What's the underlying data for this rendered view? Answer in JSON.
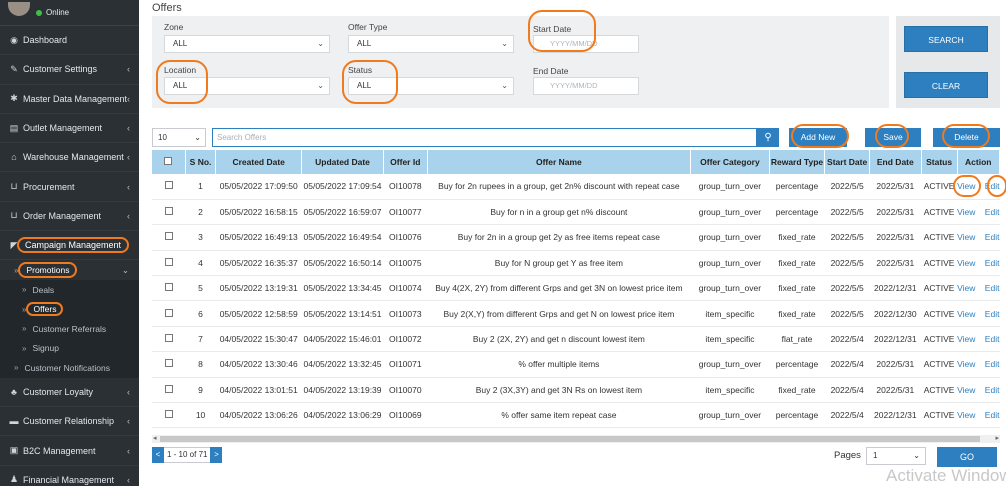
{
  "sidebar": {
    "status": "Online",
    "items": [
      {
        "label": "Dashboard",
        "icon": "dashboard-icon",
        "glyph": "◉",
        "chevron": false
      },
      {
        "label": "Customer Settings",
        "icon": "wrench-icon",
        "glyph": "✎",
        "chevron": true
      },
      {
        "label": "Master Data Management",
        "icon": "gear-icon",
        "glyph": "✱",
        "chevron": true
      },
      {
        "label": "Outlet Management",
        "icon": "outlet-icon",
        "glyph": "▤",
        "chevron": true
      },
      {
        "label": "Warehouse Management",
        "icon": "home-icon",
        "glyph": "⌂",
        "chevron": true
      },
      {
        "label": "Procurement",
        "icon": "cart-icon",
        "glyph": "⊔",
        "chevron": true
      },
      {
        "label": "Order Management",
        "icon": "cart-icon",
        "glyph": "⊔",
        "chevron": true
      }
    ],
    "campaign": "Campaign Management",
    "promotions": "Promotions",
    "promo_subs": [
      "Deals",
      "Offers",
      "Customer Referrals",
      "Signup"
    ],
    "customer_notifications": "Customer Notifications",
    "items_after": [
      {
        "label": "Customer Loyalty",
        "icon": "users-icon",
        "glyph": "♣"
      },
      {
        "label": "Customer Relationship",
        "icon": "relationship-icon",
        "glyph": "▬"
      },
      {
        "label": "B2C Management",
        "icon": "image-icon",
        "glyph": "▣"
      },
      {
        "label": "Financial Management",
        "icon": "money-icon",
        "glyph": "♟"
      }
    ]
  },
  "page": {
    "title": "Offers"
  },
  "filters": {
    "zone_label": "Zone",
    "zone_value": "ALL",
    "offer_type_label": "Offer Type",
    "offer_type_value": "ALL",
    "start_date_label": "Start Date",
    "start_date_placeholder": "YYYY/MM/DD",
    "location_label": "Location",
    "location_value": "ALL",
    "status_label": "Status",
    "status_value": "ALL",
    "end_date_label": "End Date",
    "end_date_placeholder": "YYYY/MM/DD"
  },
  "actions": {
    "search": "SEARCH",
    "clear": "CLEAR"
  },
  "toolbar": {
    "page_size": "10",
    "search_placeholder": "Search Offers",
    "add_new": "Add New",
    "save": "Save",
    "delete": "Delete"
  },
  "table": {
    "headers": [
      "S No.",
      "Created Date",
      "Updated Date",
      "Offer Id",
      "Offer Name",
      "Offer Category",
      "Reward Type",
      "Start Date",
      "End Date",
      "Status",
      "Action"
    ],
    "view_label": "View",
    "edit_label": "Edit",
    "rows": [
      {
        "sno": "1",
        "created": "05/05/2022 17:09:50",
        "updated": "05/05/2022 17:09:54",
        "id": "OI10078",
        "name": "Buy for 2n rupees in a group, get 2n% discount with repeat case",
        "category": "group_turn_over",
        "reward": "percentage",
        "start": "2022/5/5",
        "end": "2022/5/31",
        "status": "ACTIVE"
      },
      {
        "sno": "2",
        "created": "05/05/2022 16:58:15",
        "updated": "05/05/2022 16:59:07",
        "id": "OI10077",
        "name": "Buy for n in a group get n% discount",
        "category": "group_turn_over",
        "reward": "percentage",
        "start": "2022/5/5",
        "end": "2022/5/31",
        "status": "ACTIVE"
      },
      {
        "sno": "3",
        "created": "05/05/2022 16:49:13",
        "updated": "05/05/2022 16:49:54",
        "id": "OI10076",
        "name": "Buy for 2n in a group get 2y as free items repeat case",
        "category": "group_turn_over",
        "reward": "fixed_rate",
        "start": "2022/5/5",
        "end": "2022/5/31",
        "status": "ACTIVE"
      },
      {
        "sno": "4",
        "created": "05/05/2022 16:35:37",
        "updated": "05/05/2022 16:50:14",
        "id": "OI10075",
        "name": "Buy for N group get Y as free item",
        "category": "group_turn_over",
        "reward": "fixed_rate",
        "start": "2022/5/5",
        "end": "2022/5/31",
        "status": "ACTIVE"
      },
      {
        "sno": "5",
        "created": "05/05/2022 13:19:31",
        "updated": "05/05/2022 13:34:45",
        "id": "OI10074",
        "name": "Buy 4(2X, 2Y) from different Grps and get 3N on lowest price item",
        "category": "group_turn_over",
        "reward": "fixed_rate",
        "start": "2022/5/5",
        "end": "2022/12/31",
        "status": "ACTIVE"
      },
      {
        "sno": "6",
        "created": "05/05/2022 12:58:59",
        "updated": "05/05/2022 13:14:51",
        "id": "OI10073",
        "name": "Buy 2(X,Y) from different Grps and get N on lowest price item",
        "category": "item_specific",
        "reward": "fixed_rate",
        "start": "2022/5/5",
        "end": "2022/12/30",
        "status": "ACTIVE"
      },
      {
        "sno": "7",
        "created": "04/05/2022 15:30:47",
        "updated": "04/05/2022 15:46:01",
        "id": "OI10072",
        "name": "Buy 2 (2X, 2Y) and get n discount lowest item",
        "category": "item_specific",
        "reward": "flat_rate",
        "start": "2022/5/4",
        "end": "2022/12/31",
        "status": "ACTIVE"
      },
      {
        "sno": "8",
        "created": "04/05/2022 13:30:46",
        "updated": "04/05/2022 13:32:45",
        "id": "OI10071",
        "name": "% offer multiple items",
        "category": "group_turn_over",
        "reward": "percentage",
        "start": "2022/5/4",
        "end": "2022/5/31",
        "status": "ACTIVE"
      },
      {
        "sno": "9",
        "created": "04/05/2022 13:01:51",
        "updated": "04/05/2022 13:19:39",
        "id": "OI10070",
        "name": "Buy 2 (3X,3Y) and get 3N Rs on lowest item",
        "category": "item_specific",
        "reward": "fixed_rate",
        "start": "2022/5/4",
        "end": "2022/5/31",
        "status": "ACTIVE"
      },
      {
        "sno": "10",
        "created": "04/05/2022 13:06:26",
        "updated": "04/05/2022 13:06:29",
        "id": "OI10069",
        "name": "% offer same item repeat case",
        "category": "group_turn_over",
        "reward": "percentage",
        "start": "2022/5/4",
        "end": "2022/12/31",
        "status": "ACTIVE"
      }
    ]
  },
  "pager": {
    "info": "1 - 10 of 71",
    "pages_label": "Pages",
    "page_value": "1",
    "go": "GO"
  },
  "watermark": "Activate Windows",
  "colors": {
    "sidebar": "#2b3035",
    "primary": "#2d7fbf",
    "header_row": "#a9d2ec",
    "annotation": "#f07a1e"
  }
}
